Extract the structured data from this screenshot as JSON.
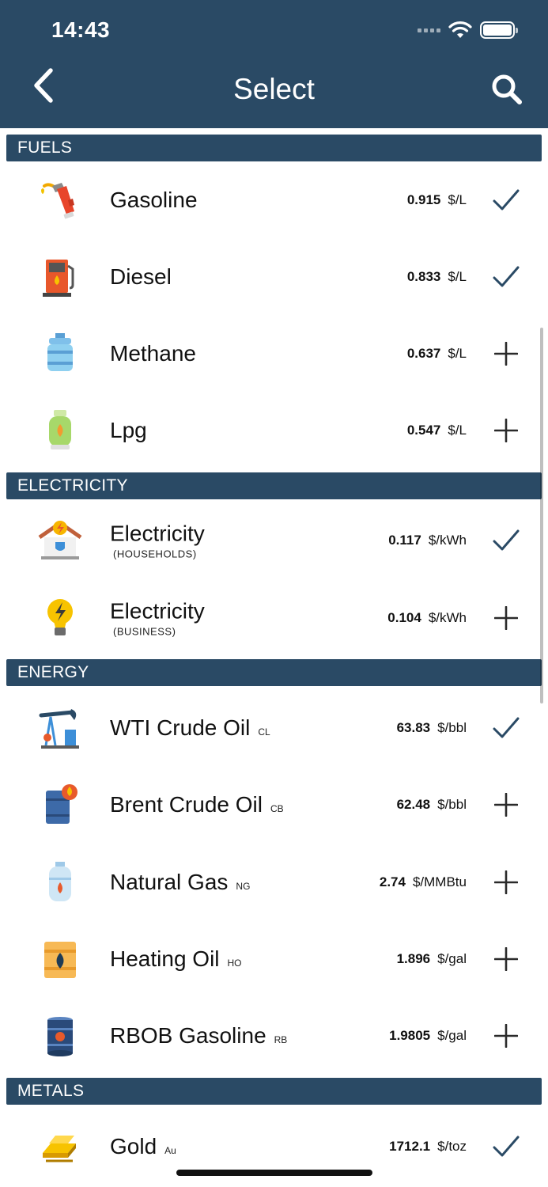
{
  "status_bar": {
    "time": "14:43"
  },
  "header": {
    "title": "Select"
  },
  "sections": {
    "fuels": "FUELS",
    "electricity": "ELECTRICITY",
    "energy": "ENERGY",
    "metals": "METALS"
  },
  "items": [
    {
      "name": "Gasoline",
      "code": "",
      "sub": "",
      "price": "0.915",
      "unit": "$/L",
      "selected": true,
      "icon": "fuel-nozzle-icon"
    },
    {
      "name": "Diesel",
      "code": "",
      "sub": "",
      "price": "0.833",
      "unit": "$/L",
      "selected": true,
      "icon": "fuel-pump-icon"
    },
    {
      "name": "Methane",
      "code": "",
      "sub": "",
      "price": "0.637",
      "unit": "$/L",
      "selected": false,
      "icon": "gas-tank-icon"
    },
    {
      "name": "Lpg",
      "code": "",
      "sub": "",
      "price": "0.547",
      "unit": "$/L",
      "selected": false,
      "icon": "lpg-cylinder-icon"
    },
    {
      "name": "Electricity",
      "code": "",
      "sub": "(HOUSEHOLDS)",
      "price": "0.117",
      "unit": "$/kWh",
      "selected": true,
      "icon": "house-power-icon"
    },
    {
      "name": "Electricity",
      "code": "",
      "sub": "(BUSINESS)",
      "price": "0.104",
      "unit": "$/kWh",
      "selected": false,
      "icon": "lightbulb-icon"
    },
    {
      "name": "WTI Crude Oil",
      "code": "CL",
      "sub": "",
      "price": "63.83",
      "unit": "$/bbl",
      "selected": true,
      "icon": "oil-pumpjack-icon"
    },
    {
      "name": "Brent Crude Oil",
      "code": "CB",
      "sub": "",
      "price": "62.48",
      "unit": "$/bbl",
      "selected": false,
      "icon": "oil-barrel-icon"
    },
    {
      "name": "Natural Gas",
      "code": "NG",
      "sub": "",
      "price": "2.74",
      "unit": "$/MMBtu",
      "selected": false,
      "icon": "gas-flame-tank-icon"
    },
    {
      "name": "Heating Oil",
      "code": "HO",
      "sub": "",
      "price": "1.896",
      "unit": "$/gal",
      "selected": false,
      "icon": "heating-oil-drum-icon"
    },
    {
      "name": "RBOB Gasoline",
      "code": "RB",
      "sub": "",
      "price": "1.9805",
      "unit": "$/gal",
      "selected": false,
      "icon": "fuel-barrel-icon"
    },
    {
      "name": "Gold",
      "code": "Au",
      "sub": "",
      "price": "1712.1",
      "unit": "$/toz",
      "selected": true,
      "icon": "gold-bars-icon"
    }
  ],
  "colors": {
    "header_bg": "#2a4a65",
    "accent": "#2a4a65"
  }
}
